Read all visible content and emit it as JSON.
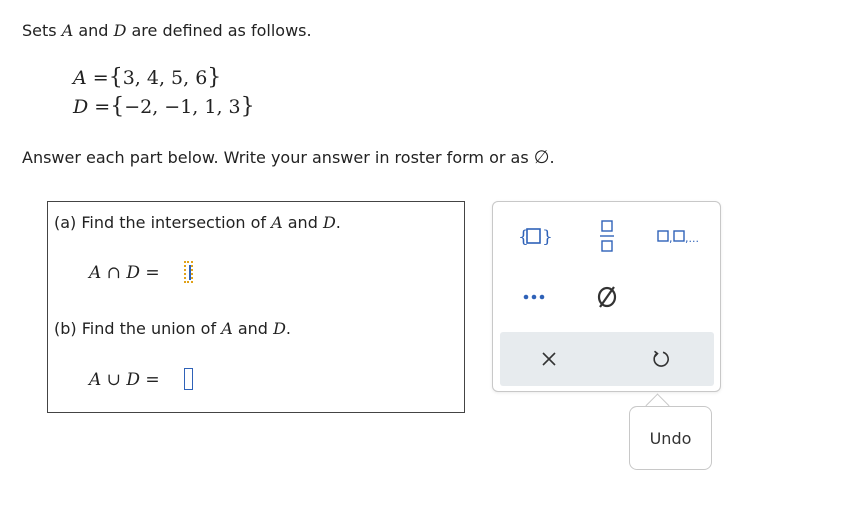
{
  "intro": {
    "prefix": "Sets",
    "set_a": "A",
    "conj": "and",
    "set_d": "D",
    "suffix": "are defined as follows."
  },
  "definitions": [
    {
      "name": "A",
      "elements": "3, 4, 5, 6"
    },
    {
      "name": "D",
      "elements": "−2, −1, 1, 3"
    }
  ],
  "instructions": {
    "text": "Answer each part below. Write your answer in roster form or as",
    "empty_symbol": "∅",
    "end": "."
  },
  "part_a": {
    "label": "(a) Find the intersection of",
    "set1": "A",
    "and": "and",
    "set2": "D",
    "period": ".",
    "expr_left": "A",
    "operator": "∩",
    "expr_right": "D",
    "equals": "=",
    "value": ""
  },
  "part_b": {
    "label": "(b) Find the union of",
    "set1": "A",
    "and": "and",
    "set2": "D",
    "period": ".",
    "expr_left": "A",
    "operator": "∪",
    "expr_right": "D",
    "equals": "=",
    "value": ""
  },
  "palette": {
    "buttons": [
      "set-braces-icon",
      "fraction-icon",
      "list-icon",
      "ellipsis-icon",
      "empty-set-icon"
    ],
    "actions": [
      "clear-icon",
      "undo-icon"
    ]
  },
  "tooltip": {
    "text": "Undo"
  },
  "colors": {
    "accent": "#2f62b8",
    "active_slot": "#e0a21a",
    "action_bar": "#e7ebee"
  }
}
